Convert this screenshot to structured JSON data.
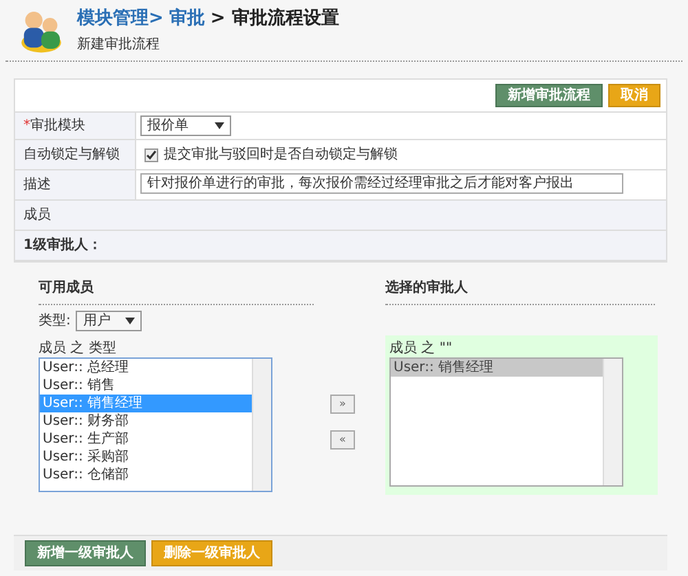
{
  "header": {
    "breadcrumb": [
      {
        "label": "模块管理>",
        "kind": "link"
      },
      {
        "label": "审批",
        "kind": "link"
      },
      {
        "label": "> 审批流程设置",
        "kind": "current"
      }
    ],
    "subtitle": "新建审批流程"
  },
  "toolbar": {
    "buttons": [
      {
        "label": "新增审批流程",
        "kind": "green"
      },
      {
        "label": "取消",
        "kind": "orange"
      }
    ]
  },
  "form": {
    "module": {
      "label": "审批模块",
      "required_mark": "*",
      "value": "报价单"
    },
    "auto_lock": {
      "label": "自动锁定与解锁",
      "checked": true,
      "text": "提交审批与驳回时是否自动锁定与解锁"
    },
    "description": {
      "label": "描述",
      "value": "针对报价单进行的审批，每次报价需经过经理审批之后才能对客户报出"
    },
    "members_label": "成员",
    "level_label": "1级审批人："
  },
  "available": {
    "title": "可用成员",
    "type_label": "类型:",
    "type_value": "用户",
    "list_label": "成员 之 类型",
    "focused": true,
    "items": [
      {
        "label": "User:: 总经理",
        "selected": false
      },
      {
        "label": "User:: 销售",
        "selected": false
      },
      {
        "label": "User:: 销售经理",
        "selected": true
      },
      {
        "label": "User:: 财务部",
        "selected": false
      },
      {
        "label": "User:: 生产部",
        "selected": false
      },
      {
        "label": "User:: 采购部",
        "selected": false
      },
      {
        "label": "User:: 仓储部",
        "selected": false
      }
    ]
  },
  "move_buttons": [
    "»",
    "«"
  ],
  "chosen": {
    "title": "选择的审批人",
    "list_label": "成员 之 \"\"",
    "focused": false,
    "items": [
      {
        "label": "User:: 销售经理",
        "selected": true
      }
    ]
  },
  "footer_buttons": [
    {
      "label": "新增一级审批人",
      "kind": "green"
    },
    {
      "label": "删除一级审批人",
      "kind": "orange"
    }
  ]
}
